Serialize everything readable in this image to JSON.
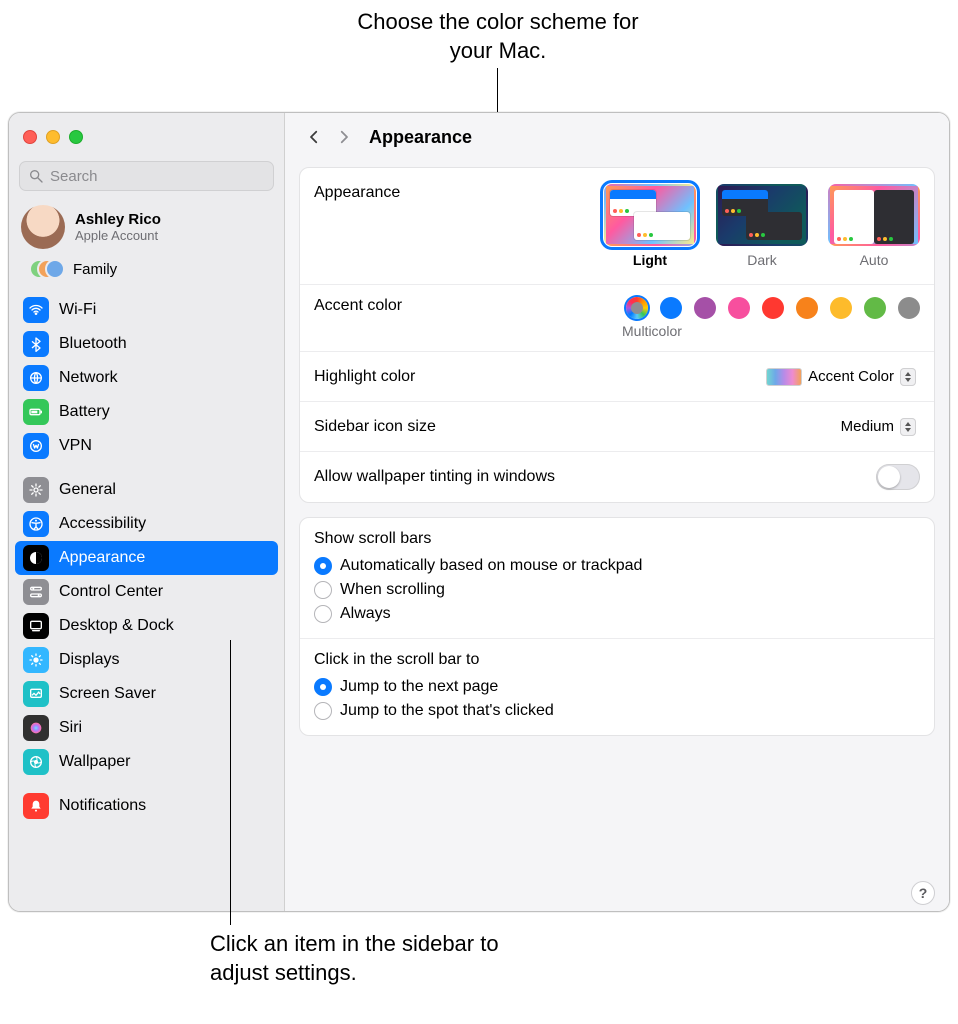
{
  "callouts": {
    "top": "Choose the color scheme for your Mac.",
    "bottom": "Click an item in the sidebar to adjust settings."
  },
  "search": {
    "placeholder": "Search",
    "value": ""
  },
  "account": {
    "name": "Ashley Rico",
    "sub": "Apple Account"
  },
  "family": {
    "label": "Family"
  },
  "sidebar": {
    "groups": [
      [
        {
          "label": "Wi-Fi",
          "color": "#0a7aff",
          "icon": "wifi"
        },
        {
          "label": "Bluetooth",
          "color": "#0a7aff",
          "icon": "bluetooth"
        },
        {
          "label": "Network",
          "color": "#0a7aff",
          "icon": "globe"
        },
        {
          "label": "Battery",
          "color": "#34c759",
          "icon": "battery"
        },
        {
          "label": "VPN",
          "color": "#0a7aff",
          "icon": "vpn"
        }
      ],
      [
        {
          "label": "General",
          "color": "#8e8e93",
          "icon": "gear"
        },
        {
          "label": "Accessibility",
          "color": "#0a7aff",
          "icon": "accessibility"
        },
        {
          "label": "Appearance",
          "color": "#000000",
          "icon": "appearance",
          "selected": true
        },
        {
          "label": "Control Center",
          "color": "#8e8e93",
          "icon": "control-center"
        },
        {
          "label": "Desktop & Dock",
          "color": "#000000",
          "icon": "desktop-dock"
        },
        {
          "label": "Displays",
          "color": "#33b7ff",
          "icon": "displays"
        },
        {
          "label": "Screen Saver",
          "color": "#1fc1c7",
          "icon": "screen-saver"
        },
        {
          "label": "Siri",
          "color": "#303030",
          "icon": "siri"
        },
        {
          "label": "Wallpaper",
          "color": "#1fc1c7",
          "icon": "wallpaper"
        }
      ],
      [
        {
          "label": "Notifications",
          "color": "#ff3b30",
          "icon": "notifications"
        }
      ]
    ]
  },
  "header": {
    "title": "Appearance"
  },
  "appearance": {
    "label": "Appearance",
    "options": [
      {
        "label": "Light",
        "selected": true
      },
      {
        "label": "Dark"
      },
      {
        "label": "Auto"
      }
    ]
  },
  "accent": {
    "label": "Accent color",
    "selected_name": "Multicolor",
    "colors": [
      {
        "name": "Multicolor",
        "hex": "multicolor",
        "selected": true
      },
      {
        "name": "Blue",
        "hex": "#0a7aff"
      },
      {
        "name": "Purple",
        "hex": "#a550a7"
      },
      {
        "name": "Pink",
        "hex": "#f74f9e"
      },
      {
        "name": "Red",
        "hex": "#ff3830"
      },
      {
        "name": "Orange",
        "hex": "#f7821b"
      },
      {
        "name": "Yellow",
        "hex": "#fdbb2b"
      },
      {
        "name": "Green",
        "hex": "#62ba46"
      },
      {
        "name": "Graphite",
        "hex": "#8c8c8c"
      }
    ]
  },
  "highlight": {
    "label": "Highlight color",
    "value": "Accent Color"
  },
  "sidebar_icon": {
    "label": "Sidebar icon size",
    "value": "Medium"
  },
  "wallpaper_tint": {
    "label": "Allow wallpaper tinting in windows",
    "on": false
  },
  "scrollbars": {
    "title": "Show scroll bars",
    "options": [
      {
        "label": "Automatically based on mouse or trackpad",
        "checked": true
      },
      {
        "label": "When scrolling"
      },
      {
        "label": "Always"
      }
    ]
  },
  "scroll_click": {
    "title": "Click in the scroll bar to",
    "options": [
      {
        "label": "Jump to the next page",
        "checked": true
      },
      {
        "label": "Jump to the spot that's clicked"
      }
    ]
  },
  "help": "?"
}
